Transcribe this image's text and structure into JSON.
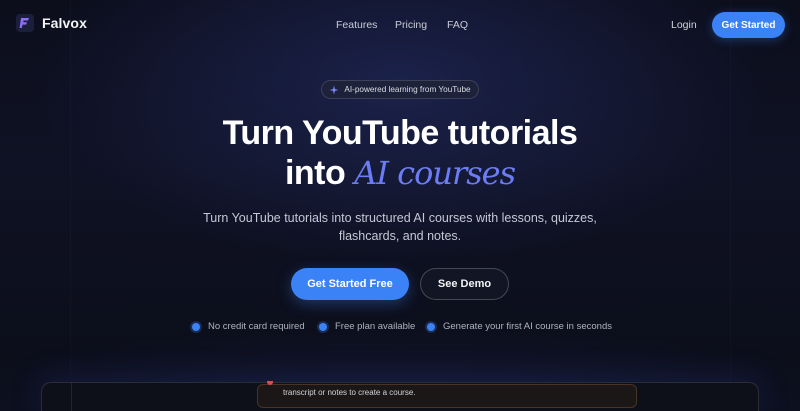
{
  "app": {
    "name": "Falvox"
  },
  "nav": {
    "links": [
      "Features",
      "Pricing",
      "FAQ"
    ],
    "login": "Login",
    "cta": "Get Started"
  },
  "hero": {
    "badge": "AI-powered learning from YouTube",
    "title_line1": "Turn YouTube tutorials",
    "title_line2_plain": "into",
    "title_line2_accent": "AI courses",
    "subtitle": "Turn YouTube tutorials into structured AI courses with lessons, quizzes, flashcards, and notes.",
    "primary_cta": "Get Started Free",
    "secondary_cta": "See Demo",
    "features": [
      "No credit card required",
      "Free plan available",
      "Generate your first AI course in seconds"
    ]
  },
  "preview": {
    "text": "transcript or notes to create a course."
  },
  "colors": {
    "accent": "#3b82f6",
    "accent_script": "#6b7cf5",
    "background": "#0b0d18"
  }
}
